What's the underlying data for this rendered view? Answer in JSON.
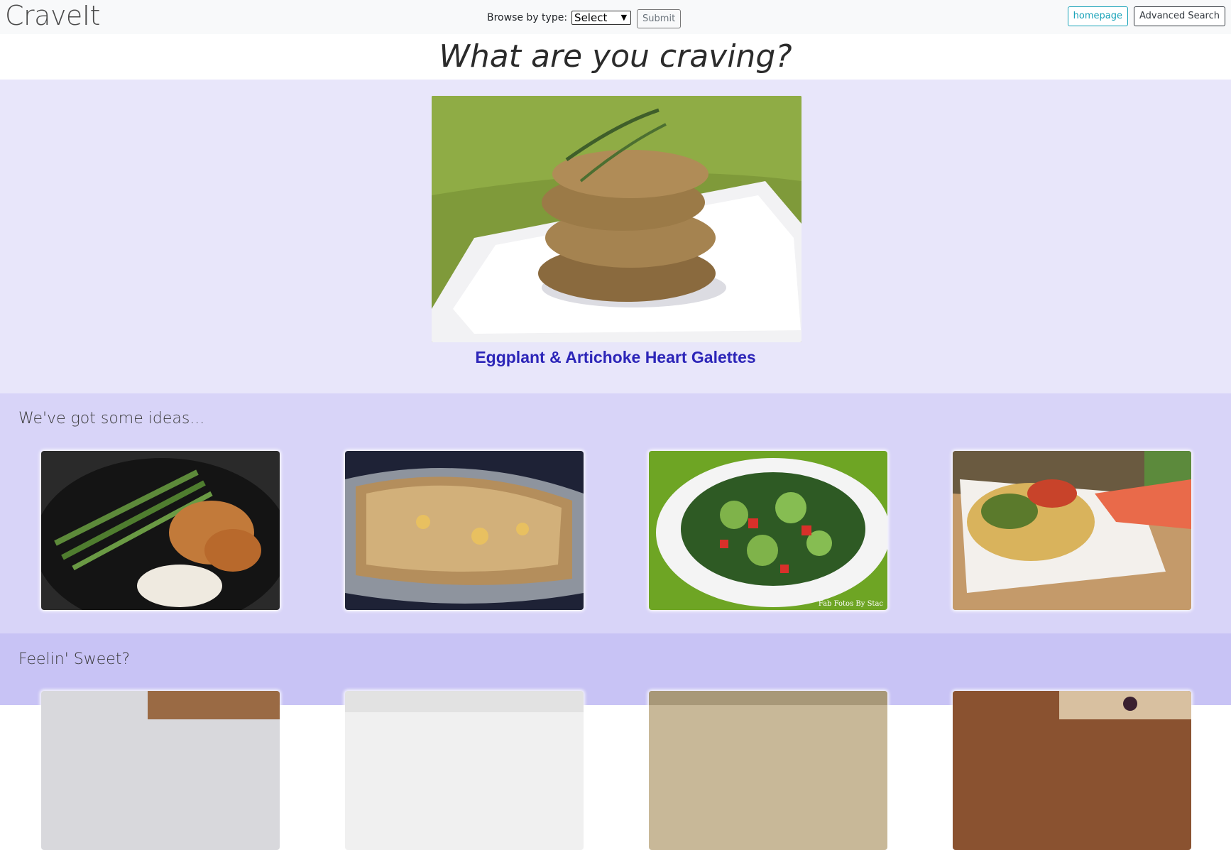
{
  "navbar": {
    "brand": "CraveIt",
    "browse_label": "Browse by type:",
    "browse_select_value": "Select",
    "submit_label": "Submit",
    "homepage_label": "homepage",
    "advanced_search_label": "Advanced Search"
  },
  "hero": {
    "title": "What are you craving?"
  },
  "featured": {
    "recipe_title": "Eggplant & Artichoke Heart Galettes",
    "image": "galettes-photo"
  },
  "ideas_section": {
    "heading": "We've got some ideas...",
    "items": [
      {
        "image": "curry-asparagus-rice-photo"
      },
      {
        "image": "baked-casserole-photo"
      },
      {
        "image": "cucumber-tomato-salad-photo",
        "watermark": "Fab Fotos By Stac"
      },
      {
        "image": "frittata-salsa-photo"
      }
    ]
  },
  "sweet_section": {
    "heading": "Feelin' Sweet?",
    "items": [
      {
        "image": "dessert-photo-1"
      },
      {
        "image": "dessert-photo-2"
      },
      {
        "image": "dessert-photo-3"
      },
      {
        "image": "dessert-photo-4"
      }
    ]
  },
  "colors": {
    "navbar_bg": "#f8f9fa",
    "featured_bg": "#e8e6fa",
    "ideas_bg": "#d8d4f8",
    "sweet_bg": "#c8c3f5",
    "recipe_title": "#2c25b8",
    "homepage_btn": "#17a2b8"
  }
}
